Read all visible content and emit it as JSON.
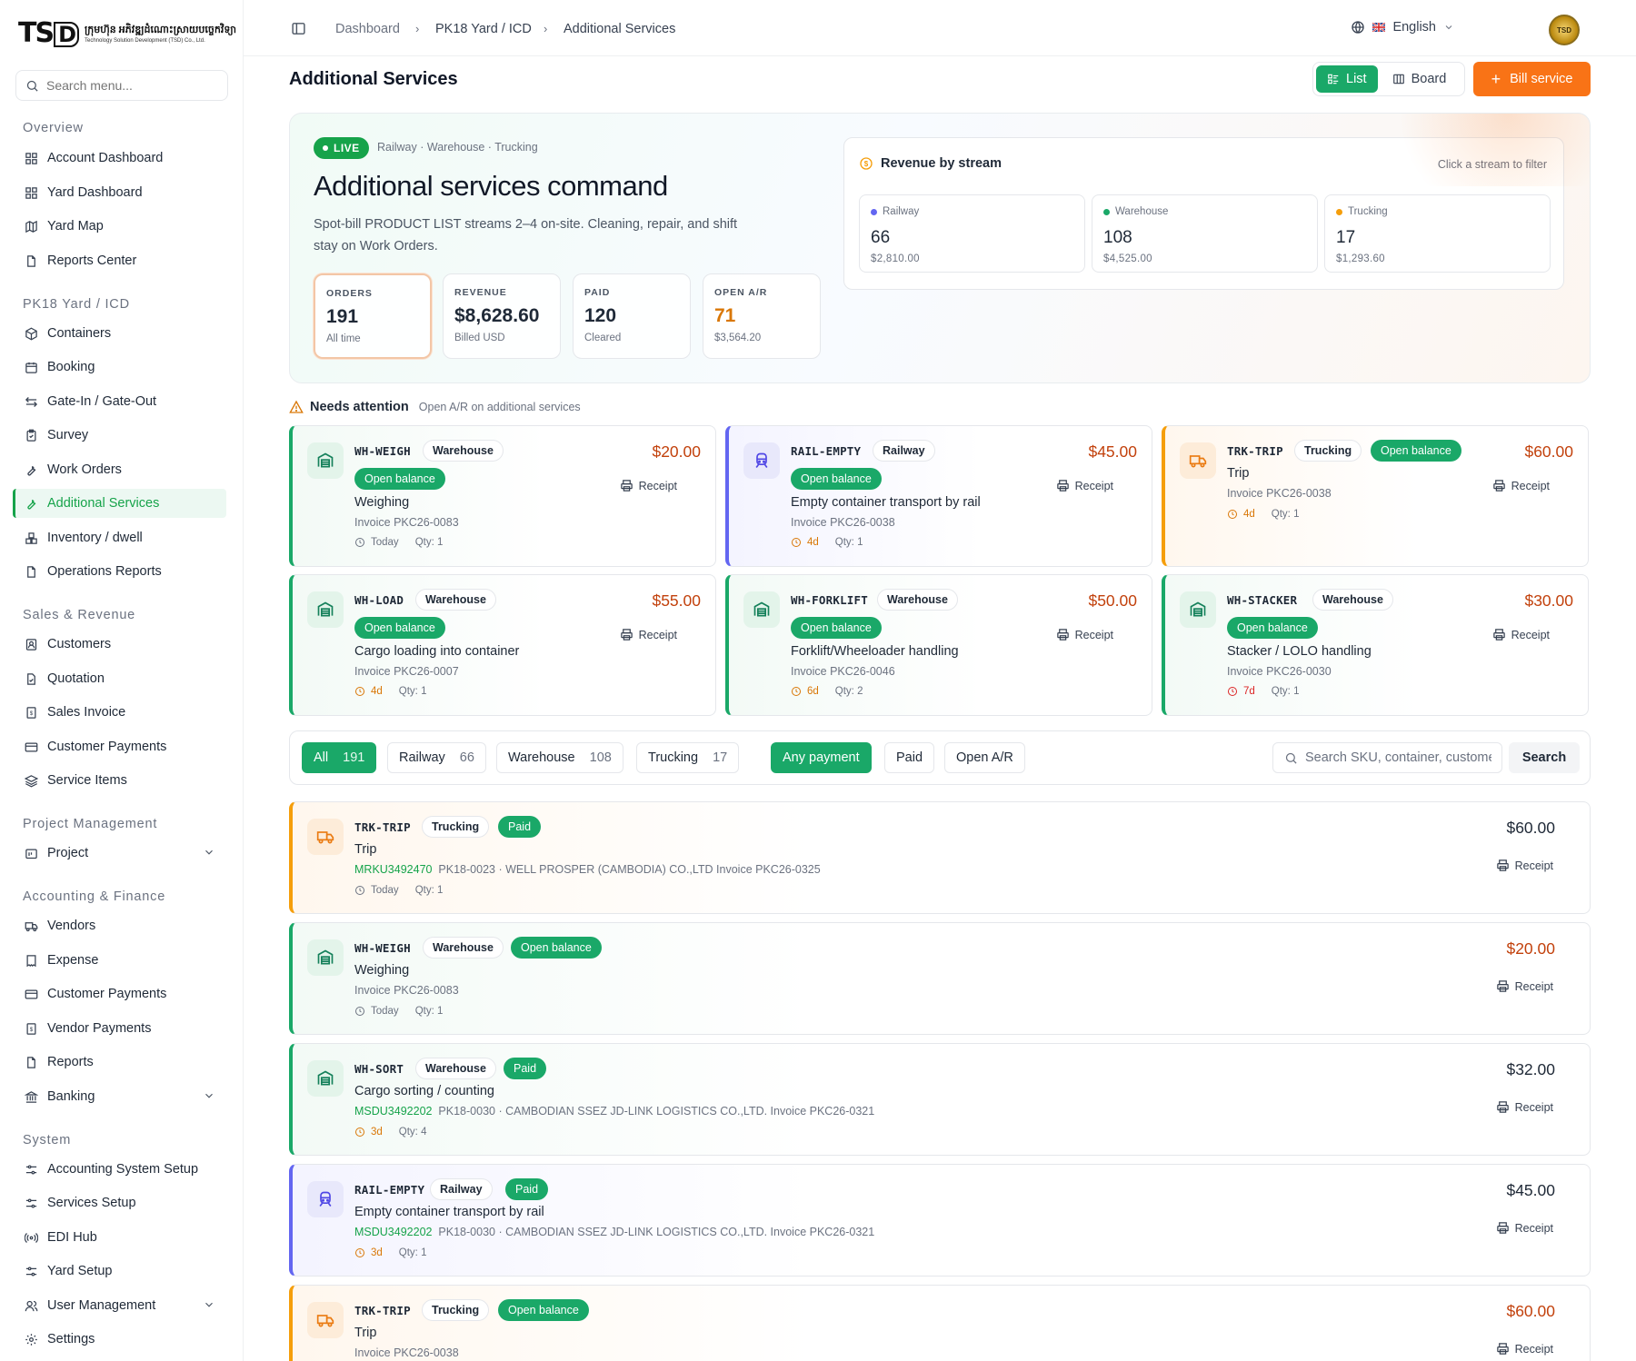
{
  "brand": {
    "logo_mark": "TSD",
    "khmer_name": "ក្រុមហ៊ុន អភិវឌ្ឍដំណោះស្រាយបច្ចេកវិទ្យា",
    "english_name": "Technology Solution Development (TSD) Co., Ltd."
  },
  "sidebar": {
    "search_placeholder": "Search menu...",
    "sections": {
      "overview": "Overview",
      "yard": "PK18 Yard / ICD",
      "sales": "Sales & Revenue",
      "project": "Project Management",
      "accounting": "Accounting & Finance",
      "system": "System"
    },
    "items": {
      "account_dashboard": "Account Dashboard",
      "yard_dashboard": "Yard Dashboard",
      "yard_map": "Yard Map",
      "reports_center": "Reports Center",
      "containers": "Containers",
      "booking": "Booking",
      "gate": "Gate-In / Gate-Out",
      "survey": "Survey",
      "work_orders": "Work Orders",
      "additional_services": "Additional Services",
      "inventory": "Inventory / dwell",
      "operations_reports": "Operations Reports",
      "customers": "Customers",
      "quotation": "Quotation",
      "sales_invoice": "Sales Invoice",
      "customer_payments": "Customer Payments",
      "service_items": "Service Items",
      "project": "Project",
      "vendors": "Vendors",
      "expense": "Expense",
      "customer_payments_2": "Customer Payments",
      "vendor_payments": "Vendor Payments",
      "reports": "Reports",
      "banking": "Banking",
      "accounting_setup": "Accounting System Setup",
      "services_setup": "Services Setup",
      "edi_hub": "EDI Hub",
      "yard_setup": "Yard Setup",
      "user_management": "User Management",
      "settings": "Settings"
    }
  },
  "topbar": {
    "crumb1": "Dashboard",
    "crumb2": "PK18 Yard / ICD",
    "crumb3": "Additional Services",
    "language": "English",
    "avatar_text": "TSD"
  },
  "header": {
    "title": "Additional Services",
    "view_list": "List",
    "view_board": "Board",
    "bill_service": "Bill service"
  },
  "hero": {
    "live": "LIVE",
    "tags": "Railway · Warehouse · Trucking",
    "title": "Additional services command",
    "desc": "Spot-bill PRODUCT LIST streams 2–4 on-site. Cleaning, repair, and shift stay on Work Orders.",
    "kpis": {
      "orders": {
        "label": "ORDERS",
        "value": "191",
        "sub": "All time"
      },
      "revenue": {
        "label": "REVENUE",
        "value": "$8,628.60",
        "sub": "Billed USD"
      },
      "paid": {
        "label": "PAID",
        "value": "120",
        "sub": "Cleared"
      },
      "open": {
        "label": "OPEN A/R",
        "value": "71",
        "sub": "$3,564.20"
      }
    },
    "revenue_by_stream": {
      "title": "Revenue by stream",
      "hint": "Click a stream to filter",
      "streams": {
        "railway": {
          "name": "Railway",
          "count": "66",
          "amount": "$2,810.00",
          "color": "#6366f1"
        },
        "warehouse": {
          "name": "Warehouse",
          "count": "108",
          "amount": "$4,525.00",
          "color": "#1aa868"
        },
        "trucking": {
          "name": "Trucking",
          "count": "17",
          "amount": "$1,293.60",
          "color": "#f59e0b"
        }
      }
    }
  },
  "attention": {
    "title": "Needs attention",
    "subtitle": "Open A/R on additional services",
    "cards": {
      "c1": {
        "sku": "WH-WEIGH",
        "stream": "Warehouse",
        "status": "Open balance",
        "amount": "$20.00",
        "service": "Weighing",
        "invoice": "Invoice PKC26-0083",
        "age": "Today",
        "qty": "Qty: 1"
      },
      "c2": {
        "sku": "RAIL-EMPTY",
        "stream": "Railway",
        "status": "Open balance",
        "amount": "$45.00",
        "service": "Empty container transport by rail",
        "invoice": "Invoice PKC26-0038",
        "age": "4d",
        "qty": "Qty: 1"
      },
      "c3": {
        "sku": "TRK-TRIP",
        "stream": "Trucking",
        "status": "Open balance",
        "amount": "$60.00",
        "service": "Trip",
        "invoice": "Invoice PKC26-0038",
        "age": "4d",
        "qty": "Qty: 1"
      },
      "c4": {
        "sku": "WH-LOAD",
        "stream": "Warehouse",
        "status": "Open balance",
        "amount": "$55.00",
        "service": "Cargo loading into container",
        "invoice": "Invoice PKC26-0007",
        "age": "4d",
        "qty": "Qty: 1"
      },
      "c5": {
        "sku": "WH-FORKLIFT",
        "stream": "Warehouse",
        "status": "Open balance",
        "amount": "$50.00",
        "service": "Forklift/Wheeloader handling",
        "invoice": "Invoice PKC26-0046",
        "age": "6d",
        "qty": "Qty: 2"
      },
      "c6": {
        "sku": "WH-STACKER",
        "stream": "Warehouse",
        "status": "Open balance",
        "amount": "$30.00",
        "service": "Stacker / LOLO handling",
        "invoice": "Invoice PKC26-0030",
        "age": "7d",
        "qty": "Qty: 1"
      }
    },
    "receipt": "Receipt"
  },
  "filters": {
    "all": {
      "label": "All",
      "count": "191"
    },
    "railway": {
      "label": "Railway",
      "count": "66"
    },
    "warehouse": {
      "label": "Warehouse",
      "count": "108"
    },
    "trucking": {
      "label": "Trucking",
      "count": "17"
    },
    "any_payment": "Any payment",
    "paid": "Paid",
    "open_ar": "Open A/R",
    "search_placeholder": "Search SKU, container, customer",
    "search_button": "Search"
  },
  "list": {
    "r1": {
      "sku": "TRK-TRIP",
      "stream": "Trucking",
      "status": "Paid",
      "amount": "$60.00",
      "service": "Trip",
      "container": "MRKU3492470",
      "detail": "PK18-0023 · WELL PROSPER   (CAMBODIA)  CO.,LTD   Invoice PKC26-0325",
      "age": "Today",
      "qty": "Qty: 1"
    },
    "r2": {
      "sku": "WH-WEIGH",
      "stream": "Warehouse",
      "status": "Open balance",
      "amount": "$20.00",
      "service": "Weighing",
      "container": "",
      "detail": "Invoice PKC26-0083",
      "age": "Today",
      "qty": "Qty: 1"
    },
    "r3": {
      "sku": "WH-SORT",
      "stream": "Warehouse",
      "status": "Paid",
      "amount": "$32.00",
      "service": "Cargo sorting / counting",
      "container": "MSDU3492202",
      "detail": "PK18-0030 · CAMBODIAN SSEZ JD-LINK LOGISTICS CO.,LTD.  Invoice PKC26-0321",
      "age": "3d",
      "qty": "Qty: 4"
    },
    "r4": {
      "sku": "RAIL-EMPTY",
      "stream": "Railway",
      "status": "Paid",
      "amount": "$45.00",
      "service": "Empty container transport by rail",
      "container": "MSDU3492202",
      "detail": "PK18-0030 · CAMBODIAN SSEZ JD-LINK LOGISTICS CO.,LTD.  Invoice PKC26-0321",
      "age": "3d",
      "qty": "Qty: 1"
    },
    "r5": {
      "sku": "TRK-TRIP",
      "stream": "Trucking",
      "status": "Open balance",
      "amount": "$60.00",
      "service": "Trip",
      "container": "",
      "detail": "Invoice PKC26-0038",
      "age": "",
      "qty": ""
    }
  }
}
